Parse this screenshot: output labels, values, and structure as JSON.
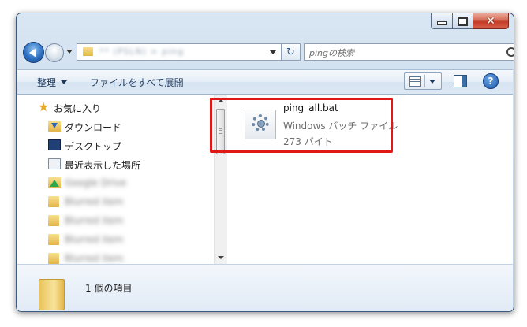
{
  "window": {
    "caption": {
      "minimize": "",
      "maximize": "",
      "close": "✕"
    }
  },
  "address": {
    "path_text": "** (PSLN) > ping",
    "refresh_glyph": "↻"
  },
  "search": {
    "placeholder": "pingの検索"
  },
  "toolbar": {
    "organize_label": "整理",
    "show_all_files_label": "ファイルをすべて展開",
    "help_glyph": "?"
  },
  "navigation": {
    "items": [
      {
        "label": "お気に入り",
        "icon": "star-icon"
      },
      {
        "label": "ダウンロード",
        "icon": "download-folder-icon"
      },
      {
        "label": "デスクトップ",
        "icon": "desktop-icon"
      },
      {
        "label": "最近表示した場所",
        "icon": "recent-places-icon"
      },
      {
        "label": "Google Drive",
        "icon": "google-drive-icon"
      },
      {
        "label": "Blurred item",
        "icon": "folder-icon"
      },
      {
        "label": "Blurred item",
        "icon": "folder-icon"
      },
      {
        "label": "Blurred item",
        "icon": "folder-icon"
      },
      {
        "label": "Blurred item",
        "icon": "folder-icon"
      }
    ]
  },
  "file": {
    "name": "ping_all.bat",
    "type": "Windows バッチ ファイル",
    "size": "273 バイト",
    "icon": "batch-file-gear-icon"
  },
  "details": {
    "count_text": "1 個の項目",
    "icon": "folder-icon"
  },
  "colors": {
    "highlight": "#e01818",
    "frame": "#c5d8ec"
  }
}
